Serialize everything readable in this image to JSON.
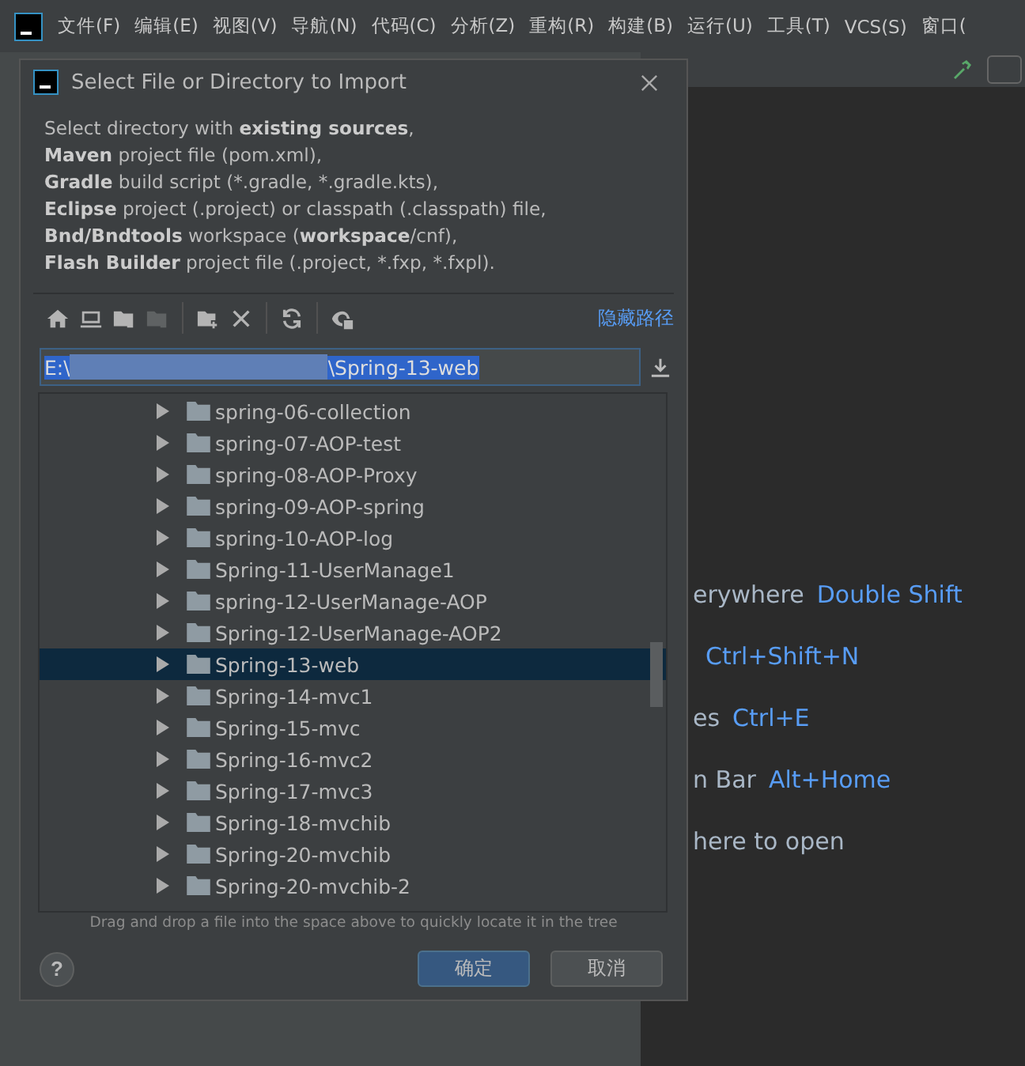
{
  "menu": [
    "文件(F)",
    "编辑(E)",
    "视图(V)",
    "导航(N)",
    "代码(C)",
    "分析(Z)",
    "重构(R)",
    "构建(B)",
    "运行(U)",
    "工具(T)",
    "VCS(S)",
    "窗口("
  ],
  "dialog": {
    "title": "Select File or Directory to Import",
    "description": [
      "Select directory with **existing sources**,",
      "**Maven** project file (pom.xml),",
      "**Gradle** build script (*.gradle, *.gradle.kts),",
      "**Eclipse** project (.project) or classpath (.classpath) file,",
      "**Bnd/Bndtools** workspace (**workspace**/cnf),",
      "**Flash Builder** project file (.project, *.fxp, *.fxpl)."
    ],
    "toolbar": [
      {
        "kind": "home",
        "disabled": false
      },
      {
        "kind": "desktop",
        "disabled": false
      },
      {
        "kind": "project",
        "disabled": false
      },
      {
        "kind": "module",
        "disabled": true
      },
      {
        "kind": "sep"
      },
      {
        "kind": "newfolder",
        "disabled": false
      },
      {
        "kind": "delete",
        "disabled": false
      },
      {
        "kind": "sep"
      },
      {
        "kind": "refresh",
        "disabled": false
      },
      {
        "kind": "sep"
      },
      {
        "kind": "hidden",
        "disabled": false
      }
    ],
    "hide_path_link": "隐藏路径",
    "path": {
      "start": "E:\\",
      "end": "\\Spring-13-web"
    },
    "tree": [
      {
        "name": "spring-06-collection",
        "selected": false
      },
      {
        "name": "spring-07-AOP-test",
        "selected": false
      },
      {
        "name": "spring-08-AOP-Proxy",
        "selected": false
      },
      {
        "name": "spring-09-AOP-spring",
        "selected": false
      },
      {
        "name": "spring-10-AOP-log",
        "selected": false
      },
      {
        "name": "Spring-11-UserManage1",
        "selected": false
      },
      {
        "name": "spring-12-UserManage-AOP",
        "selected": false
      },
      {
        "name": "Spring-12-UserManage-AOP2",
        "selected": false
      },
      {
        "name": "Spring-13-web",
        "selected": true
      },
      {
        "name": "Spring-14-mvc1",
        "selected": false
      },
      {
        "name": "Spring-15-mvc",
        "selected": false
      },
      {
        "name": "Spring-16-mvc2",
        "selected": false
      },
      {
        "name": "Spring-17-mvc3",
        "selected": false
      },
      {
        "name": "Spring-18-mvchib",
        "selected": false
      },
      {
        "name": "Spring-20-mvchib",
        "selected": false
      },
      {
        "name": "Spring-20-mvchib-2",
        "selected": false
      }
    ],
    "hint": "Drag and drop a file into the space above to quickly locate it in the tree",
    "ok": "确定",
    "cancel": "取消",
    "help": "?"
  },
  "welcome": [
    {
      "text": "erywhere",
      "shortcut": "Double Shift"
    },
    {
      "shortcut": "Ctrl+Shift+N"
    },
    {
      "text": "es",
      "shortcut": "Ctrl+E"
    },
    {
      "text": "n Bar",
      "shortcut": "Alt+Home"
    },
    {
      "text": "here to open"
    }
  ]
}
